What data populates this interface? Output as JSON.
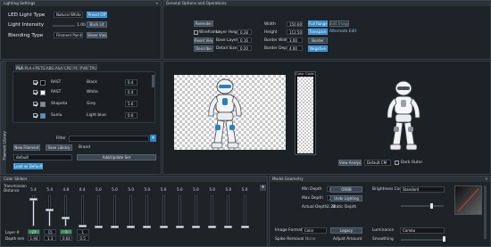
{
  "lighting": {
    "title": "Lighting Settings",
    "led_label": "LED Light Type",
    "led_value": "Natural White 4000K",
    "set_button": "Preset Off",
    "intensity_label": "Light Intensity",
    "intensity_value": "1.00",
    "intensity_level": 0.85,
    "back_button": "Back Lit",
    "blending_label": "Blending Type",
    "blending_value": "Filament Painting",
    "sheer_button": "Sheer View"
  },
  "general": {
    "title": "General Options and Operations",
    "rows": [
      {
        "button": "Rerender",
        "label": "",
        "value": ""
      },
      {
        "button": "Wireframe",
        "label": "Layer Height",
        "value": "0.28"
      },
      {
        "button": "Reset View",
        "label": "Base Layer",
        "value": "0.16"
      },
      {
        "button": "Describe",
        "label": "Detail Size",
        "value": "0.20"
      }
    ],
    "wire_checkbox": "Wireframe",
    "width_label": "Width",
    "width_value": "150.00",
    "height_label": "Height",
    "height_value": "112.50",
    "border_width_label": "Border Width",
    "border_width_value": "3.00",
    "border_depth_label": "Border Depth",
    "border_depth_value": "4.00",
    "full_range": "Full Range",
    "edit_image": "Edit Image",
    "transparent": "Transparent",
    "alternate_edit": "Alternate Edit",
    "border": "Border",
    "negative": "Negative"
  },
  "filament": {
    "side_label": "Filament Library",
    "tabs": [
      "PLA",
      "PLA+",
      "PETG",
      "ABS",
      "ASA",
      "CPE",
      "PC",
      "PVB",
      "TPU"
    ],
    "rows": [
      {
        "brand": "RAST",
        "name": "Black",
        "value": "0.4",
        "color": "#000000",
        "checked": true
      },
      {
        "brand": "RAST",
        "name": "White",
        "value": "0.4",
        "color": "#ffffff",
        "checked": true
      },
      {
        "brand": "Shapeta",
        "name": "Grey",
        "value": "5.6",
        "color": "#8a8f94",
        "checked": true
      },
      {
        "brand": "Sunlu",
        "name": "Light blue",
        "value": "0.6",
        "color": "#3b9ee0",
        "checked": true
      }
    ],
    "filter_label": "Filter",
    "new_filament": "New Filament",
    "save_library": "Save Library",
    "brand_label": "Brand",
    "default_value": "default",
    "add_update": "Add/Update Set",
    "load_defaults": "Load w/ Defaults"
  },
  "preview": {
    "color_code_label": "Color Code",
    "view_analysis": "View Analysis",
    "default_cm": "Default CM",
    "dark_outer": "Dark Outer"
  },
  "sliders": {
    "title": "Color Sliders",
    "transmission_label": "Transmission Distance",
    "layer_label": "Layer #",
    "depth_label": "Depth mm",
    "items": [
      {
        "value": "5.4",
        "level": 0.9,
        "layer": "27",
        "depth": "1.94",
        "layer_highlight": true
      },
      {
        "value": "5.4",
        "level": 0.55,
        "layer": "15",
        "depth": "1.3"
      },
      {
        "value": "4.8",
        "level": 0.3,
        "layer": "5",
        "depth": "0.64",
        "layer_highlight": true
      },
      {
        "value": "0.4",
        "level": 0.04,
        "layer": "1",
        "depth": "0.5"
      },
      {
        "value": "5.0",
        "level": 0.0,
        "layer": "",
        "depth": ""
      },
      {
        "value": "5.0",
        "level": 0.0,
        "layer": "",
        "depth": ""
      },
      {
        "value": "5.0",
        "level": 0.0,
        "layer": "",
        "depth": ""
      },
      {
        "value": "5.0",
        "level": 0.0,
        "layer": "",
        "depth": ""
      },
      {
        "value": "5.0",
        "level": 0.0,
        "layer": "",
        "depth": ""
      },
      {
        "value": "5.0",
        "level": 0.0,
        "layer": "",
        "depth": ""
      },
      {
        "value": "5.0",
        "level": 0.0,
        "layer": "",
        "depth": ""
      },
      {
        "value": "5.0",
        "level": 0.0,
        "layer": "",
        "depth": ""
      },
      {
        "value": "5.0",
        "level": 0.0,
        "layer": "",
        "depth": ""
      },
      {
        "value": "5.0",
        "level": 0.0,
        "layer": "",
        "depth": ""
      }
    ]
  },
  "model": {
    "title": "Model Geometry",
    "min_depth_label": "Min Depth",
    "min_depth_value": "0.48",
    "max_depth_label": "Max Depth",
    "max_depth_value": "2.24",
    "actual_depth_label": "Actual Depth",
    "actual_depth_value": "2.24",
    "static_depth_label": "Static Depth",
    "orbit_button": "ORBB",
    "undo_lighting": "Undo Lighting",
    "brightness_label": "Brightness Comp",
    "brightness_value": "Standard",
    "image_format_label": "Image Format",
    "image_format_value": "Color",
    "legacy_button": "Legacy",
    "luminance_label": "Luminance",
    "luminance_value": "Combo",
    "spike_label": "Spike Removal",
    "spike_value": "None",
    "adjust_label": "Adjust Amount",
    "smoothing_label": "Smoothing"
  }
}
